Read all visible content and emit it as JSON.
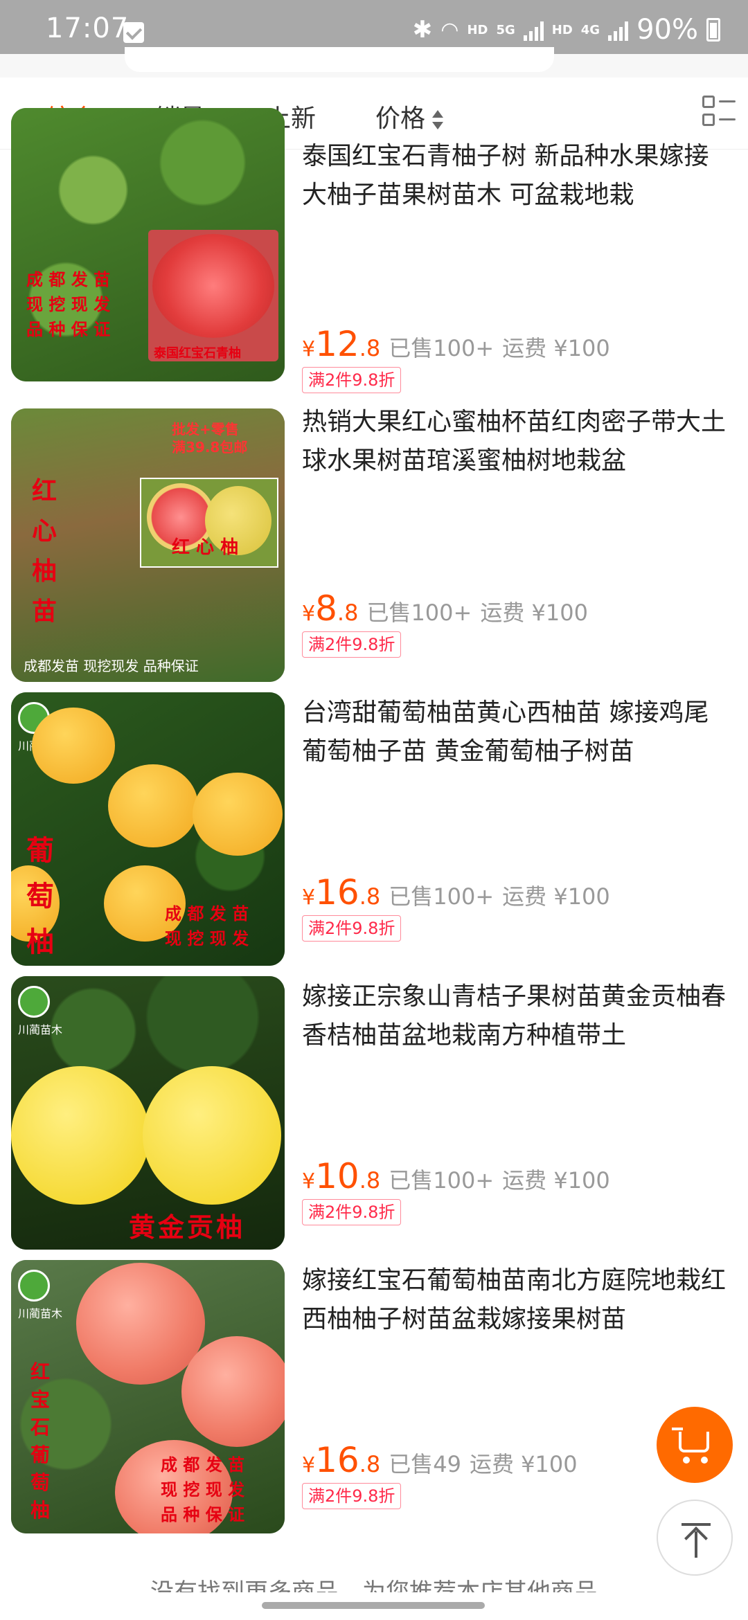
{
  "status_bar": {
    "time": "17:07",
    "hd1": "HD",
    "net1": "5G",
    "hd2": "HD",
    "net2": "4G",
    "battery": "90%"
  },
  "sort_tabs": [
    {
      "label": "综合",
      "active": true
    },
    {
      "label": "销量",
      "active": false
    },
    {
      "label": "上新",
      "active": false
    },
    {
      "label": "价格",
      "active": false
    }
  ],
  "products": [
    {
      "title": "泰国红宝石青柚子树 新品种水果嫁接大柚子苗果树苗木 可盆栽地栽",
      "currency": "¥",
      "price_int": "12",
      "price_dec": ".8",
      "sold": "已售100+",
      "shipping": "运费 ¥100",
      "promo": "满2件9.8折",
      "thumb_text": [
        "成 都 发 苗",
        "现 挖 现 发",
        "品 种 保 证",
        "泰国红宝石青柚"
      ]
    },
    {
      "title": "热销大果红心蜜柚杯苗红肉密子带大土球水果树苗琯溪蜜柚树地栽盆",
      "currency": "¥",
      "price_int": "8",
      "price_dec": ".8",
      "sold": "已售100+",
      "shipping": "运费 ¥100",
      "promo": "满2件9.8折",
      "thumb_text": [
        "红",
        "心",
        "柚",
        "苗",
        "红 心 柚",
        "批发+零售",
        "满39.8包邮",
        "成都发苗  现挖现发  品种保证"
      ]
    },
    {
      "title": "台湾甜葡萄柚苗黄心西柚苗 嫁接鸡尾葡萄柚子苗 黄金葡萄柚子树苗",
      "currency": "¥",
      "price_int": "16",
      "price_dec": ".8",
      "sold": "已售100+",
      "shipping": "运费 ¥100",
      "promo": "满2件9.8折",
      "thumb_text": [
        "葡",
        "萄",
        "柚",
        "成 都 发 苗",
        "现 挖 现 发",
        "川蔺苗木"
      ]
    },
    {
      "title": "嫁接正宗象山青桔子果树苗黄金贡柚春香桔柚苗盆地栽南方种植带土",
      "currency": "¥",
      "price_int": "10",
      "price_dec": ".8",
      "sold": "已售100+",
      "shipping": "运费 ¥100",
      "promo": "满2件9.8折",
      "thumb_text": [
        "黄金贡柚",
        "川蔺苗木"
      ]
    },
    {
      "title": "嫁接红宝石葡萄柚苗南北方庭院地栽红西柚柚子树苗盆栽嫁接果树苗",
      "currency": "¥",
      "price_int": "16",
      "price_dec": ".8",
      "sold": "已售49",
      "shipping": "运费 ¥100",
      "promo": "满2件9.8折",
      "thumb_text": [
        "红",
        "宝",
        "石",
        "葡",
        "萄",
        "柚",
        "成 都 发 苗",
        "现 挖 现 发",
        "品 种 保 证",
        "川蔺苗木"
      ]
    }
  ],
  "footer_hint": "— 没有找到更多商品，为您推荐本店其他商品 —",
  "colors": {
    "accent": "#ff5000",
    "promo": "#ff2a4a",
    "status_bar": "#a9a9a9"
  },
  "icons": [
    "bluetooth-icon",
    "wifi-icon",
    "signal-icon",
    "battery-icon",
    "sort-arrows-icon",
    "layout-toggle-icon",
    "cart-icon",
    "back-to-top-icon"
  ]
}
